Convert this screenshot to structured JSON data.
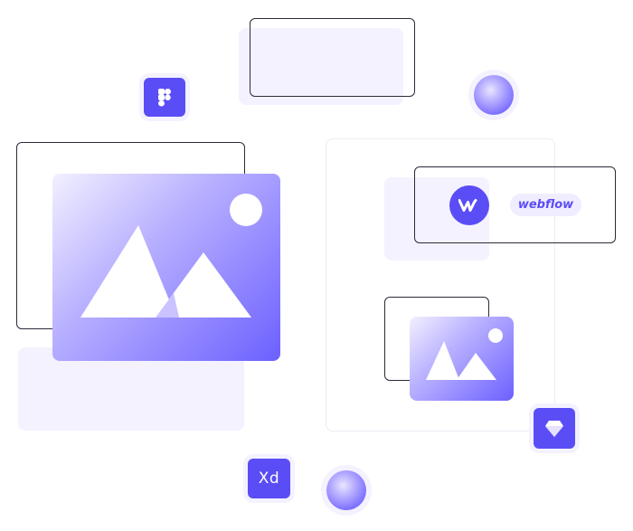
{
  "brand": {
    "accent": "#5b4df5",
    "soft_fill": "#f4f2ff",
    "outline": "#2b2b3a"
  },
  "icons": {
    "figma": "figma-icon",
    "sketch": "sketch-diamond-icon",
    "xd": "adobe-xd-icon",
    "webflow": "webflow-icon",
    "image": "image-placeholder-icon"
  },
  "labels": {
    "xd": "Xd",
    "webflow_pill": "webflow"
  }
}
